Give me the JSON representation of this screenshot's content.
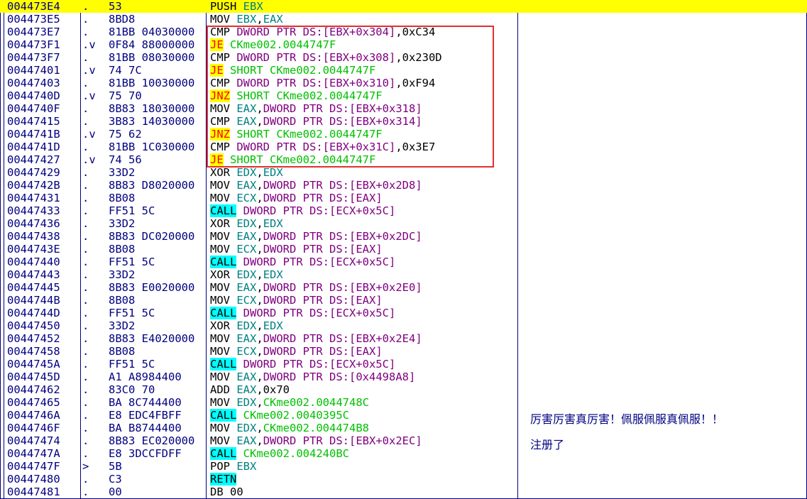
{
  "rows": [
    {
      "addr": "004473E4",
      "mark": ".",
      "hex": "53",
      "dis": [
        [
          "PUSH",
          "op"
        ],
        [
          " ",
          ""
        ],
        [
          "EBX",
          "reg"
        ]
      ]
    },
    {
      "addr": "004473E5",
      "mark": ".",
      "hex": "8BD8",
      "dis": [
        [
          "MOV",
          "op"
        ],
        [
          " ",
          ""
        ],
        [
          "EBX",
          "reg"
        ],
        [
          ",",
          ""
        ],
        [
          "EAX",
          "reg"
        ]
      ]
    },
    {
      "addr": "004473E7",
      "mark": ".",
      "hex": "81BB 04030000",
      "dis": [
        [
          "CMP",
          "op"
        ],
        [
          " ",
          ""
        ],
        [
          "DWORD PTR DS:[EBX+0x304]",
          "mem"
        ],
        [
          ",0xC34",
          "plain"
        ]
      ]
    },
    {
      "addr": "004473F1",
      "mark": ".v",
      "hex": "0F84 88000000",
      "dis": [
        [
          "JE",
          "jhl"
        ],
        [
          " ",
          ""
        ],
        [
          "CKme002.0044747F",
          "jmp"
        ]
      ]
    },
    {
      "addr": "004473F7",
      "mark": ".",
      "hex": "81BB 08030000",
      "dis": [
        [
          "CMP",
          "op"
        ],
        [
          " ",
          ""
        ],
        [
          "DWORD PTR DS:[EBX+0x308]",
          "mem"
        ],
        [
          ",0x230D",
          "plain"
        ]
      ]
    },
    {
      "addr": "00447401",
      "mark": ".v",
      "hex": "74 7C",
      "dis": [
        [
          "JE",
          "jhl"
        ],
        [
          " ",
          ""
        ],
        [
          "SHORT CKme002.0044747F",
          "jmp"
        ]
      ]
    },
    {
      "addr": "00447403",
      "mark": ".",
      "hex": "81BB 10030000",
      "dis": [
        [
          "CMP",
          "op"
        ],
        [
          " ",
          ""
        ],
        [
          "DWORD PTR DS:[EBX+0x310]",
          "mem"
        ],
        [
          ",0xF94",
          "plain"
        ]
      ]
    },
    {
      "addr": "0044740D",
      "mark": ".v",
      "hex": "75 70",
      "dis": [
        [
          "JNZ",
          "jhl"
        ],
        [
          " ",
          ""
        ],
        [
          "SHORT CKme002.0044747F",
          "jmp"
        ]
      ]
    },
    {
      "addr": "0044740F",
      "mark": ".",
      "hex": "8B83 18030000",
      "dis": [
        [
          "MOV",
          "op"
        ],
        [
          " ",
          ""
        ],
        [
          "EAX",
          "reg"
        ],
        [
          ",",
          ""
        ],
        [
          "DWORD PTR DS:[EBX+0x318]",
          "mem"
        ]
      ]
    },
    {
      "addr": "00447415",
      "mark": ".",
      "hex": "3B83 14030000",
      "dis": [
        [
          "CMP",
          "op"
        ],
        [
          " ",
          ""
        ],
        [
          "EAX",
          "reg"
        ],
        [
          ",",
          ""
        ],
        [
          "DWORD PTR DS:[EBX+0x314]",
          "mem"
        ]
      ]
    },
    {
      "addr": "0044741B",
      "mark": ".v",
      "hex": "75 62",
      "dis": [
        [
          "JNZ",
          "jhl"
        ],
        [
          " ",
          ""
        ],
        [
          "SHORT CKme002.0044747F",
          "jmp"
        ]
      ]
    },
    {
      "addr": "0044741D",
      "mark": ".",
      "hex": "81BB 1C030000",
      "dis": [
        [
          "CMP",
          "op"
        ],
        [
          " ",
          ""
        ],
        [
          "DWORD PTR DS:[EBX+0x31C]",
          "mem"
        ],
        [
          ",0x3E7",
          "plain"
        ]
      ]
    },
    {
      "addr": "00447427",
      "mark": ".v",
      "hex": "74 56",
      "dis": [
        [
          "JE",
          "jhl"
        ],
        [
          " ",
          ""
        ],
        [
          "SHORT CKme002.0044747F",
          "jmp"
        ]
      ]
    },
    {
      "addr": "00447429",
      "mark": ".",
      "hex": "33D2",
      "dis": [
        [
          "XOR",
          "op"
        ],
        [
          " ",
          ""
        ],
        [
          "EDX",
          "reg"
        ],
        [
          ",",
          ""
        ],
        [
          "EDX",
          "reg"
        ]
      ]
    },
    {
      "addr": "0044742B",
      "mark": ".",
      "hex": "8B83 D8020000",
      "dis": [
        [
          "MOV",
          "op"
        ],
        [
          " ",
          ""
        ],
        [
          "EAX",
          "reg"
        ],
        [
          ",",
          ""
        ],
        [
          "DWORD PTR DS:[EBX+0x2D8]",
          "mem"
        ]
      ]
    },
    {
      "addr": "00447431",
      "mark": ".",
      "hex": "8B08",
      "dis": [
        [
          "MOV",
          "op"
        ],
        [
          " ",
          ""
        ],
        [
          "ECX",
          "reg"
        ],
        [
          ",",
          ""
        ],
        [
          "DWORD PTR DS:[EAX]",
          "mem"
        ]
      ]
    },
    {
      "addr": "00447433",
      "mark": ".",
      "hex": "FF51 5C",
      "dis": [
        [
          "CALL",
          "chl"
        ],
        [
          " ",
          ""
        ],
        [
          "DWORD PTR DS:[ECX+0x5C]",
          "mem"
        ]
      ]
    },
    {
      "addr": "00447436",
      "mark": ".",
      "hex": "33D2",
      "dis": [
        [
          "XOR",
          "op"
        ],
        [
          " ",
          ""
        ],
        [
          "EDX",
          "reg"
        ],
        [
          ",",
          ""
        ],
        [
          "EDX",
          "reg"
        ]
      ]
    },
    {
      "addr": "00447438",
      "mark": ".",
      "hex": "8B83 DC020000",
      "dis": [
        [
          "MOV",
          "op"
        ],
        [
          " ",
          ""
        ],
        [
          "EAX",
          "reg"
        ],
        [
          ",",
          ""
        ],
        [
          "DWORD PTR DS:[EBX+0x2DC]",
          "mem"
        ]
      ]
    },
    {
      "addr": "0044743E",
      "mark": ".",
      "hex": "8B08",
      "dis": [
        [
          "MOV",
          "op"
        ],
        [
          " ",
          ""
        ],
        [
          "ECX",
          "reg"
        ],
        [
          ",",
          ""
        ],
        [
          "DWORD PTR DS:[EAX]",
          "mem"
        ]
      ]
    },
    {
      "addr": "00447440",
      "mark": ".",
      "hex": "FF51 5C",
      "dis": [
        [
          "CALL",
          "chl"
        ],
        [
          " ",
          ""
        ],
        [
          "DWORD PTR DS:[ECX+0x5C]",
          "mem"
        ]
      ]
    },
    {
      "addr": "00447443",
      "mark": ".",
      "hex": "33D2",
      "dis": [
        [
          "XOR",
          "op"
        ],
        [
          " ",
          ""
        ],
        [
          "EDX",
          "reg"
        ],
        [
          ",",
          ""
        ],
        [
          "EDX",
          "reg"
        ]
      ]
    },
    {
      "addr": "00447445",
      "mark": ".",
      "hex": "8B83 E0020000",
      "dis": [
        [
          "MOV",
          "op"
        ],
        [
          " ",
          ""
        ],
        [
          "EAX",
          "reg"
        ],
        [
          ",",
          ""
        ],
        [
          "DWORD PTR DS:[EBX+0x2E0]",
          "mem"
        ]
      ]
    },
    {
      "addr": "0044744B",
      "mark": ".",
      "hex": "8B08",
      "dis": [
        [
          "MOV",
          "op"
        ],
        [
          " ",
          ""
        ],
        [
          "ECX",
          "reg"
        ],
        [
          ",",
          ""
        ],
        [
          "DWORD PTR DS:[EAX]",
          "mem"
        ]
      ]
    },
    {
      "addr": "0044744D",
      "mark": ".",
      "hex": "FF51 5C",
      "dis": [
        [
          "CALL",
          "chl"
        ],
        [
          " ",
          ""
        ],
        [
          "DWORD PTR DS:[ECX+0x5C]",
          "mem"
        ]
      ]
    },
    {
      "addr": "00447450",
      "mark": ".",
      "hex": "33D2",
      "dis": [
        [
          "XOR",
          "op"
        ],
        [
          " ",
          ""
        ],
        [
          "EDX",
          "reg"
        ],
        [
          ",",
          ""
        ],
        [
          "EDX",
          "reg"
        ]
      ]
    },
    {
      "addr": "00447452",
      "mark": ".",
      "hex": "8B83 E4020000",
      "dis": [
        [
          "MOV",
          "op"
        ],
        [
          " ",
          ""
        ],
        [
          "EAX",
          "reg"
        ],
        [
          ",",
          ""
        ],
        [
          "DWORD PTR DS:[EBX+0x2E4]",
          "mem"
        ]
      ]
    },
    {
      "addr": "00447458",
      "mark": ".",
      "hex": "8B08",
      "dis": [
        [
          "MOV",
          "op"
        ],
        [
          " ",
          ""
        ],
        [
          "ECX",
          "reg"
        ],
        [
          ",",
          ""
        ],
        [
          "DWORD PTR DS:[EAX]",
          "mem"
        ]
      ]
    },
    {
      "addr": "0044745A",
      "mark": ".",
      "hex": "FF51 5C",
      "dis": [
        [
          "CALL",
          "chl"
        ],
        [
          " ",
          ""
        ],
        [
          "DWORD PTR DS:[ECX+0x5C]",
          "mem"
        ]
      ]
    },
    {
      "addr": "0044745D",
      "mark": ".",
      "hex": "A1 A8984400",
      "dis": [
        [
          "MOV",
          "op"
        ],
        [
          " ",
          ""
        ],
        [
          "EAX",
          "reg"
        ],
        [
          ",",
          ""
        ],
        [
          "DWORD PTR DS:[0x4498A8]",
          "mem"
        ]
      ]
    },
    {
      "addr": "00447462",
      "mark": ".",
      "hex": "83C0 70",
      "dis": [
        [
          "ADD",
          "op"
        ],
        [
          " ",
          ""
        ],
        [
          "EAX",
          "reg"
        ],
        [
          ",0x70",
          "plain"
        ]
      ]
    },
    {
      "addr": "00447465",
      "mark": ".",
      "hex": "BA 8C744400",
      "dis": [
        [
          "MOV",
          "op"
        ],
        [
          " ",
          ""
        ],
        [
          "EDX",
          "reg"
        ],
        [
          ",",
          ""
        ],
        [
          "CKme002.0044748C",
          "jmp"
        ]
      ]
    },
    {
      "addr": "0044746A",
      "mark": ".",
      "hex": "E8 EDC4FBFF",
      "dis": [
        [
          "CALL",
          "chl"
        ],
        [
          " ",
          ""
        ],
        [
          "CKme002.0040395C",
          "jmp"
        ]
      ]
    },
    {
      "addr": "0044746F",
      "mark": ".",
      "hex": "BA B8744400",
      "dis": [
        [
          "MOV",
          "op"
        ],
        [
          " ",
          ""
        ],
        [
          "EDX",
          "reg"
        ],
        [
          ",",
          ""
        ],
        [
          "CKme002.004474B8",
          "jmp"
        ]
      ]
    },
    {
      "addr": "00447474",
      "mark": ".",
      "hex": "8B83 EC020000",
      "dis": [
        [
          "MOV",
          "op"
        ],
        [
          " ",
          ""
        ],
        [
          "EAX",
          "reg"
        ],
        [
          ",",
          ""
        ],
        [
          "DWORD PTR DS:[EBX+0x2EC]",
          "mem"
        ]
      ]
    },
    {
      "addr": "0044747A",
      "mark": ".",
      "hex": "E8 3DCCFDFF",
      "dis": [
        [
          "CALL",
          "chl"
        ],
        [
          " ",
          ""
        ],
        [
          "CKme002.004240BC",
          "jmp"
        ]
      ]
    },
    {
      "addr": "0044747F",
      "mark": ">",
      "hex": "5B",
      "dis": [
        [
          "POP",
          "op"
        ],
        [
          " ",
          ""
        ],
        [
          "EBX",
          "reg"
        ]
      ]
    },
    {
      "addr": "00447480",
      "mark": ".",
      "hex": "C3",
      "dis": [
        [
          "RETN",
          "chl"
        ]
      ]
    },
    {
      "addr": "00447481",
      "mark": ".",
      "hex": "00",
      "dis": [
        [
          "DB",
          "op"
        ],
        [
          " ",
          ""
        ],
        [
          "00",
          "plain"
        ]
      ]
    }
  ],
  "comments": [
    {
      "row": 31,
      "text": "厉害厉害真厉害！佩服佩服真佩服！！"
    },
    {
      "row": 33,
      "text": "注册了"
    }
  ],
  "colors": {
    "selection": "#ffff00",
    "address": "#000080",
    "register": "#008080",
    "memory": "#800080",
    "jump_target": "#00c000",
    "jump_highlight_bg": "#ffff00",
    "jump_highlight_fg": "#ff0000",
    "call_highlight_bg": "#00ffff",
    "box": "#e03030"
  }
}
